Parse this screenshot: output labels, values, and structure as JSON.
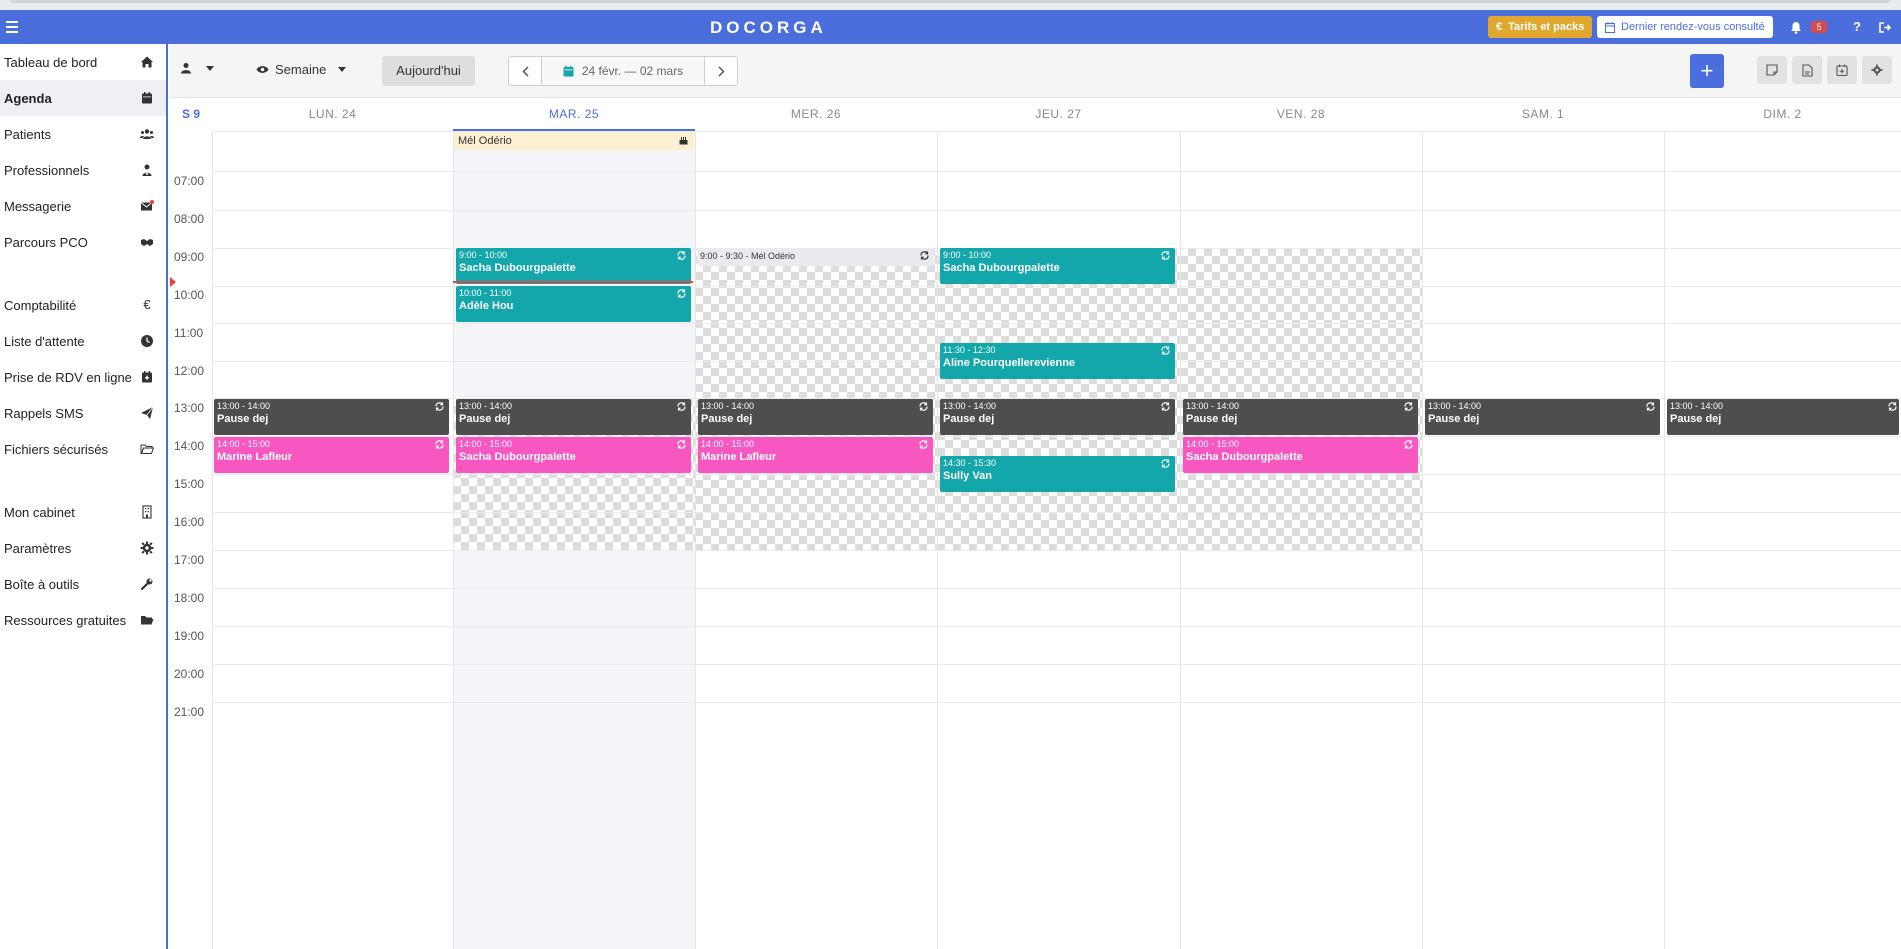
{
  "header": {
    "logo": "DOCORGA",
    "tarifs_label": "Tarifs et packs",
    "dernier_label": "Dernier rendez-vous consulté",
    "notif_count": "5",
    "help_label": "?"
  },
  "sidebar": {
    "items": [
      {
        "label": "Tableau de bord",
        "icon": "home-icon"
      },
      {
        "label": "Agenda",
        "icon": "calendar-icon"
      },
      {
        "label": "Patients",
        "icon": "users-icon"
      },
      {
        "label": "Professionnels",
        "icon": "doctor-icon"
      },
      {
        "label": "Messagerie",
        "icon": "envelope-icon"
      },
      {
        "label": "Parcours PCO",
        "icon": "handshake-icon"
      },
      {
        "label": "Comptabilité",
        "icon": "euro-icon"
      },
      {
        "label": "Liste d'attente",
        "icon": "clock-icon"
      },
      {
        "label": "Prise de RDV en ligne",
        "icon": "calendar-check-icon"
      },
      {
        "label": "Rappels SMS",
        "icon": "paper-plane-icon"
      },
      {
        "label": "Fichiers sécurisés",
        "icon": "folder-open-icon"
      },
      {
        "label": "Mon cabinet",
        "icon": "building-icon"
      },
      {
        "label": "Paramètres",
        "icon": "gear-icon"
      },
      {
        "label": "Boîte à outils",
        "icon": "wrench-icon"
      },
      {
        "label": "Ressources gratuites",
        "icon": "folder-icon"
      }
    ]
  },
  "toolbar": {
    "view_label": "Semaine",
    "today_label": "Aujourd'hui",
    "date_range": "24 févr. — 02 mars",
    "add_label": "+"
  },
  "calendar": {
    "week_label": "S 9",
    "days": [
      "LUN. 24",
      "MAR. 25",
      "MER. 26",
      "JEU. 27",
      "VEN. 28",
      "SAM. 1",
      "DIM. 2"
    ],
    "today_index": 1,
    "hours": [
      "07:00",
      "08:00",
      "09:00",
      "10:00",
      "11:00",
      "12:00",
      "13:00",
      "14:00",
      "15:00",
      "16:00",
      "17:00",
      "18:00",
      "19:00",
      "20:00",
      "21:00"
    ],
    "allday_event": "Mél Odério",
    "events": {
      "tue_0900": {
        "time": "9:00 - 10:00",
        "title": "Sacha Dubourgpalette"
      },
      "tue_1000": {
        "time": "10:00 - 11:00",
        "title": "Adèle Hou"
      },
      "wed_0900": {
        "text": "9:00 - 9:30 - Mél Odério"
      },
      "thu_0900": {
        "time": "9:00 - 10:00",
        "title": "Sacha Dubourgpalette"
      },
      "thu_1130": {
        "time": "11:30 - 12:30",
        "title": "Aline Pourquellerevienne"
      },
      "mon_1300": {
        "time": "13:00 - 14:00",
        "title": "Pause dej"
      },
      "tue_1300": {
        "time": "13:00 - 14:00",
        "title": "Pause dej"
      },
      "wed_1300": {
        "time": "13:00 - 14:00",
        "title": "Pause dej"
      },
      "thu_1300": {
        "time": "13:00 - 14:00",
        "title": "Pause dej"
      },
      "fri_1300": {
        "time": "13:00 - 14:00",
        "title": "Pause dej"
      },
      "sat_1300": {
        "time": "13:00 - 14:00",
        "title": "Pause dej"
      },
      "sun_1300": {
        "time": "13:00 - 14:00",
        "title": "Pause dej"
      },
      "mon_1400": {
        "time": "14:00 - 15:00",
        "title": "Marine Lafleur"
      },
      "tue_1400": {
        "time": "14:00 - 15:00",
        "title": "Sacha Dubourgpalette"
      },
      "wed_1400": {
        "time": "14:00 - 15:00",
        "title": "Marine Lafleur"
      },
      "thu_1430": {
        "time": "14:30 - 15:30",
        "title": "Sully Van"
      },
      "fri_1400": {
        "time": "14:00 - 15:00",
        "title": "Sacha Dubourgpalette"
      }
    }
  },
  "colors": {
    "brand": "#4a6fdc",
    "teal_event": "#13a6ab",
    "break_event": "#4e4e4e",
    "pink_event": "#f857c1",
    "tarifs": "#e0a82e",
    "now_line": "#e0443d"
  }
}
